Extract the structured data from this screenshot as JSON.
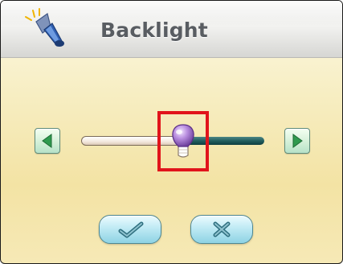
{
  "window": {
    "title": "Backlight",
    "title_icon": "flashlight-icon"
  },
  "slider": {
    "name": "backlight-level",
    "value": 0.56,
    "decrease_icon": "arrow-left-icon",
    "increase_icon": "arrow-right-icon",
    "highlighted": true
  },
  "actions": {
    "ok_icon": "checkmark-icon",
    "cancel_icon": "cross-icon"
  },
  "colors": {
    "header": "#e6e6e4",
    "panel": "#f6ebbb",
    "title_text": "#595d62",
    "track_filled": "#f3e8de",
    "track_empty": "#1f5b5b",
    "thumb": "#9b6fc4",
    "highlight": "#e1141b",
    "button": "#bfeaf4"
  }
}
